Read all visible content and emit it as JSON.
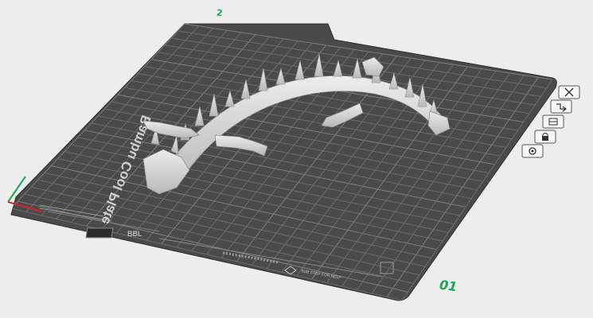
{
  "viewport": {
    "plate_name": "Bambu Cool Plate",
    "plate_number": "01",
    "plate_number_top": "2",
    "model": "articulated dragon",
    "plate_logo_text": "BBL",
    "plate_bottom_text": "SUB STEP FOR HELP"
  },
  "plate_toolbar": {
    "buttons": [
      {
        "name": "close-plate-icon",
        "glyph": "✕"
      },
      {
        "name": "arrange-icon",
        "glyph": "⇲"
      },
      {
        "name": "orient-icon",
        "glyph": "▦"
      },
      {
        "name": "lock-icon",
        "glyph": "🔒"
      },
      {
        "name": "settings-icon",
        "glyph": "⚙"
      }
    ]
  },
  "colors": {
    "background": "#ededed",
    "plate": "#4a4a4a",
    "grid": "#6c6c6c",
    "model": "#d6d6d6",
    "plate_number": "#1aa65a",
    "axis_x": "#d0262a",
    "axis_y": "#1aa65a"
  }
}
